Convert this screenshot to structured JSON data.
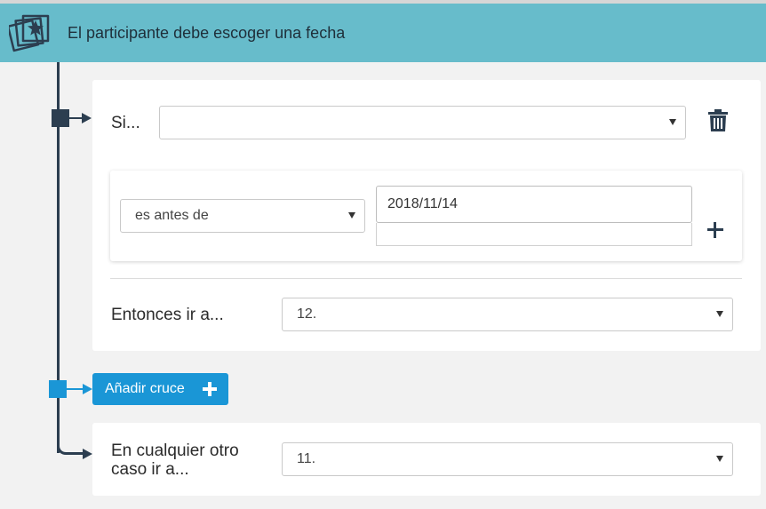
{
  "header": {
    "title": "El participante debe escoger una fecha",
    "icon": "photo-cards-star-icon"
  },
  "condition": {
    "if_label": "Si...",
    "if_select_value": "",
    "operator_value": "es antes de",
    "date_value": "2018/11/14",
    "then_label": "Entonces ir a...",
    "then_select_value": "12."
  },
  "add_button": {
    "label": "Añadir cruce"
  },
  "otherwise": {
    "label": "En cualquier otro caso ir a...",
    "select_value": "11."
  },
  "colors": {
    "header_bg": "#67bccb",
    "accent_blue": "#1a96d6",
    "dark": "#2c3e50"
  }
}
